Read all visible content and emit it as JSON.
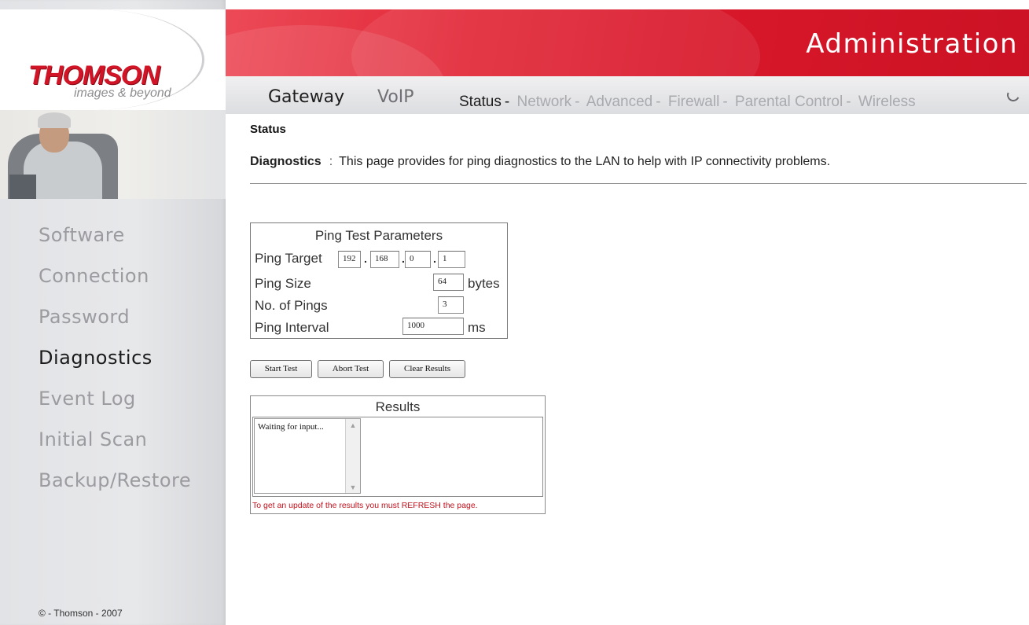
{
  "brand": {
    "logo": "THOMSON",
    "tagline": "images & beyond"
  },
  "header": {
    "title": "Administration",
    "main_tabs": [
      {
        "label": "Gateway",
        "active": true
      },
      {
        "label": "VoIP",
        "active": false
      }
    ],
    "sub_nav": [
      {
        "label": "Status",
        "active": true
      },
      {
        "label": "Network",
        "active": false
      },
      {
        "label": "Advanced",
        "active": false
      },
      {
        "label": "Firewall",
        "active": false
      },
      {
        "label": "Parental Control",
        "active": false
      },
      {
        "label": "Wireless",
        "active": false
      }
    ],
    "separator": "-"
  },
  "sidebar": {
    "items": [
      {
        "label": "Software",
        "active": false
      },
      {
        "label": "Connection",
        "active": false
      },
      {
        "label": "Password",
        "active": false
      },
      {
        "label": "Diagnostics",
        "active": true
      },
      {
        "label": "Event Log",
        "active": false
      },
      {
        "label": "Initial Scan",
        "active": false
      },
      {
        "label": "Backup/Restore",
        "active": false
      }
    ],
    "copyright": "© - Thomson - 2007"
  },
  "content": {
    "section": "Status",
    "page_name": "Diagnostics",
    "colon": ":",
    "description": "This page provides for ping diagnostics to the LAN to help with IP connectivity problems."
  },
  "ping": {
    "title": "Ping Test Parameters",
    "target_label": "Ping Target",
    "target_octets": [
      "192",
      "168",
      "0",
      "1"
    ],
    "octet_sep": ".",
    "size_label": "Ping Size",
    "size_value": "64",
    "size_unit": "bytes",
    "count_label": "No. of Pings",
    "count_value": "3",
    "interval_label": "Ping Interval",
    "interval_value": "1000",
    "interval_unit": "ms"
  },
  "buttons": {
    "start": "Start Test",
    "abort": "Abort Test",
    "clear": "Clear Results"
  },
  "results": {
    "title": "Results",
    "text": "Waiting for input...",
    "note": "To get an update of the results you must REFRESH the page."
  },
  "colors": {
    "brand_red": "#d8172a",
    "note_red": "#c3121d",
    "inactive_nav": "#9c9ca0"
  }
}
